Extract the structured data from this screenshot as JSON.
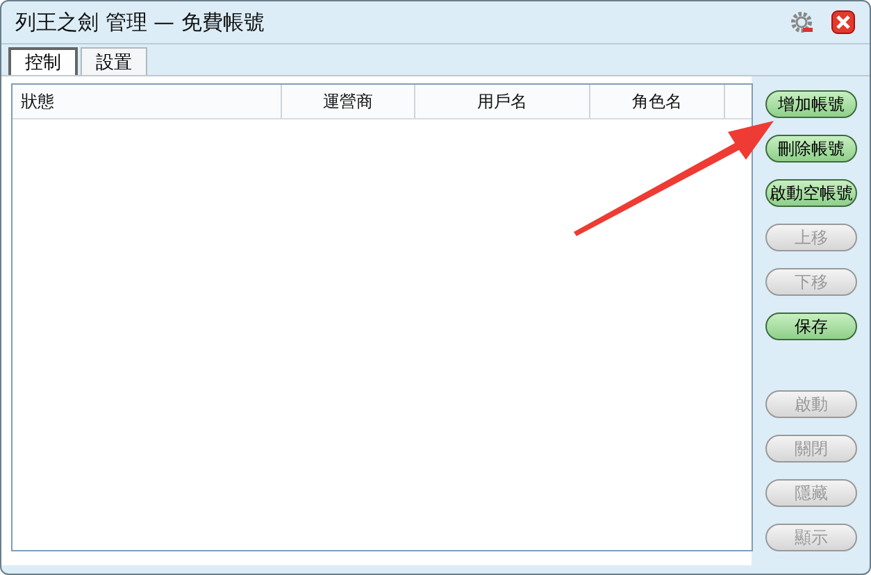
{
  "window": {
    "title": "列王之劍 管理 — 免費帳號"
  },
  "tabs": [
    {
      "label": "控制",
      "selected": true
    },
    {
      "label": "設置",
      "selected": false
    }
  ],
  "table": {
    "columns": [
      "狀態",
      "運營商",
      "用戶名",
      "角色名"
    ]
  },
  "button_groups": [
    [
      {
        "label": "增加帳號",
        "disabled": false
      },
      {
        "label": "刪除帳號",
        "disabled": false
      },
      {
        "label": "啟動空帳號",
        "disabled": false
      },
      {
        "label": "上移",
        "disabled": true
      },
      {
        "label": "下移",
        "disabled": true
      },
      {
        "label": "保存",
        "disabled": false
      }
    ],
    [
      {
        "label": "啟動",
        "disabled": true
      },
      {
        "label": "關閉",
        "disabled": true
      },
      {
        "label": "隱藏",
        "disabled": true
      },
      {
        "label": "顯示",
        "disabled": true
      }
    ]
  ]
}
